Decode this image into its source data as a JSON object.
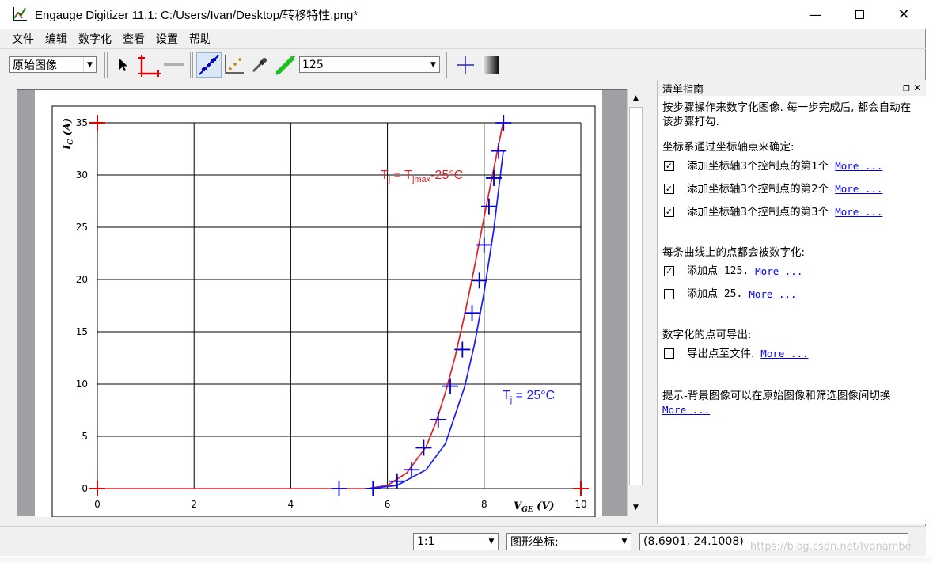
{
  "window": {
    "title": "Engauge Digitizer 11.1: C:/Users/Ivan/Desktop/转移特性.png*",
    "controls": [
      "minimize-icon",
      "maximize-icon",
      "close-icon"
    ]
  },
  "menu": [
    "文件",
    "编辑",
    "数字化",
    "查看",
    "设置",
    "帮助"
  ],
  "toolbar": {
    "background_select": "原始图像",
    "curve_select": "125"
  },
  "checklist": {
    "title": "清单指南",
    "intro": "按步骤操作来数字化图像. 每一步完成后, 都会自动在该步骤打勾.",
    "axis_header": "坐标系通过坐标轴点来确定:",
    "axis_items": [
      {
        "checked": true,
        "text": "添加坐标轴3个控制点的第1个",
        "link": "More ..."
      },
      {
        "checked": true,
        "text": "添加坐标轴3个控制点的第2个",
        "link": "More ..."
      },
      {
        "checked": true,
        "text": "添加坐标轴3个控制点的第3个",
        "link": "More ..."
      }
    ],
    "curve_header": "每条曲线上的点都会被数字化:",
    "curve_items": [
      {
        "checked": true,
        "text": "添加点 125.",
        "link": "More ..."
      },
      {
        "checked": false,
        "text": "添加点 25.",
        "link": "More ..."
      }
    ],
    "export_header": "数字化的点可导出:",
    "export_items": [
      {
        "checked": false,
        "text": "导出点至文件.",
        "link": "More ..."
      }
    ],
    "tip": "提示-背景图像可以在原始图像和筛选图像间切换",
    "tip_link": "More ..."
  },
  "status": {
    "zoom": "1:1",
    "coord_mode": "图形坐标:",
    "coords": "(8.6901, 24.1008)"
  },
  "watermark": "https://blog.csdn.net/Ivanambe",
  "chart_data": {
    "type": "line",
    "xlabel": "V_GE (V)",
    "ylabel": "I_C (A)",
    "xlim": [
      0,
      10
    ],
    "ylim": [
      0,
      35
    ],
    "x_ticks": [
      0,
      2,
      4,
      6,
      8,
      10
    ],
    "y_ticks": [
      0,
      5,
      10,
      15,
      20,
      25,
      30,
      35
    ],
    "annotations": [
      "Tj = Tjmax-25°C",
      "Tj = 25°C"
    ],
    "colors": {
      "hot": "#e21f26",
      "cold": "#1a1aff",
      "axis_marker": "#e00000",
      "point_marker": "#0000cc"
    },
    "series": [
      {
        "x": [
          5.6,
          6.0,
          6.4,
          6.8,
          7.0,
          7.2,
          7.4,
          7.6,
          7.8,
          8.0,
          8.2,
          8.4
        ],
        "y": [
          0,
          0.3,
          1.5,
          4.0,
          6.3,
          9.2,
          12.6,
          16.7,
          21.2,
          26.0,
          30.6,
          35.2
        ]
      },
      {
        "x": [
          5.6,
          6.2,
          6.8,
          7.2,
          7.6,
          7.8,
          8.0,
          8.2,
          8.4
        ],
        "y": [
          0,
          0.3,
          1.8,
          4.3,
          9.8,
          13.8,
          18.8,
          24.8,
          32.4
        ]
      }
    ],
    "axis_points": [
      [
        0,
        35
      ],
      [
        0,
        0
      ],
      [
        10,
        0
      ]
    ],
    "digitized_points": [
      [
        5.0,
        0
      ],
      [
        5.7,
        0
      ],
      [
        6.2,
        0.7
      ],
      [
        6.5,
        1.8
      ],
      [
        6.75,
        3.9
      ],
      [
        7.05,
        6.6
      ],
      [
        7.3,
        9.8
      ],
      [
        7.55,
        13.3
      ],
      [
        7.75,
        16.8
      ],
      [
        7.9,
        19.9
      ],
      [
        8.0,
        23.3
      ],
      [
        8.1,
        27.0
      ],
      [
        8.2,
        29.7
      ],
      [
        8.3,
        32.3
      ],
      [
        8.4,
        35.0
      ]
    ]
  }
}
